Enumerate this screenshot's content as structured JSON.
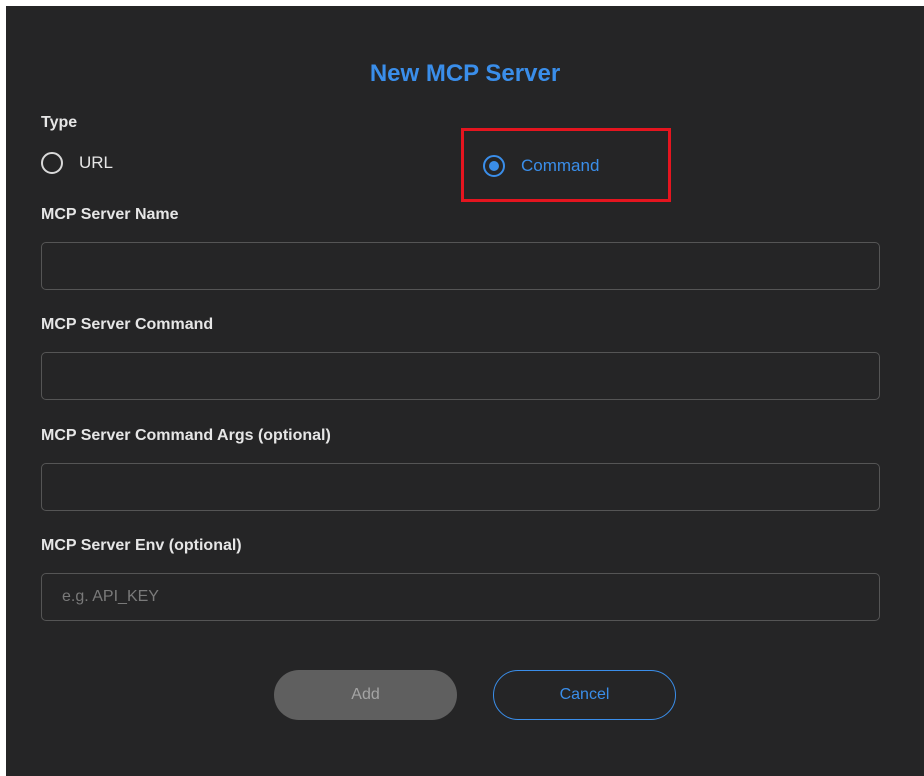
{
  "dialog": {
    "title": "New MCP Server",
    "type_label": "Type",
    "type_options": [
      {
        "label": "URL",
        "selected": false
      },
      {
        "label": "Command",
        "selected": true
      }
    ],
    "fields": {
      "name": {
        "label": "MCP Server Name",
        "value": "",
        "placeholder": ""
      },
      "command": {
        "label": "MCP Server Command",
        "value": "",
        "placeholder": ""
      },
      "args": {
        "label": "MCP Server Command Args (optional)",
        "value": "",
        "placeholder": ""
      },
      "env": {
        "label": "MCP Server Env (optional)",
        "value": "",
        "placeholder": "e.g. API_KEY"
      }
    },
    "buttons": {
      "add": "Add",
      "cancel": "Cancel"
    }
  },
  "colors": {
    "background": "#252526",
    "accent": "#3a8eea",
    "highlight": "#e5151f",
    "disabled_button": "#5f5f5f"
  }
}
